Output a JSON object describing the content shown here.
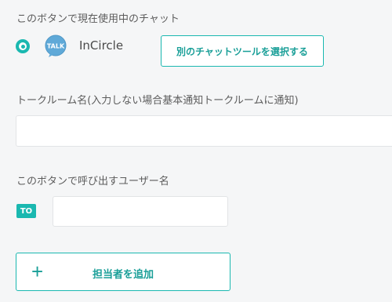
{
  "current_chat": {
    "label": "このボタンで現在使用中のチャット",
    "name": "InCircle",
    "icon": "talk-bubble-icon",
    "icon_text": "TALK",
    "select_button_label": "別のチャットツールを選択する"
  },
  "room": {
    "label": "トークルーム名(入力しない場合基本通知トークルームに通知)",
    "value": "",
    "placeholder": ""
  },
  "user": {
    "label": "このボタンで呼び出すユーザー名",
    "badge": "TO",
    "value": "",
    "placeholder": ""
  },
  "add_assignee": {
    "icon": "plus-icon",
    "icon_glyph": "+",
    "label": "担当者を追加"
  },
  "colors": {
    "accent": "#1ab8b0",
    "background": "#f5f6f7",
    "text": "#5c5c5c"
  }
}
